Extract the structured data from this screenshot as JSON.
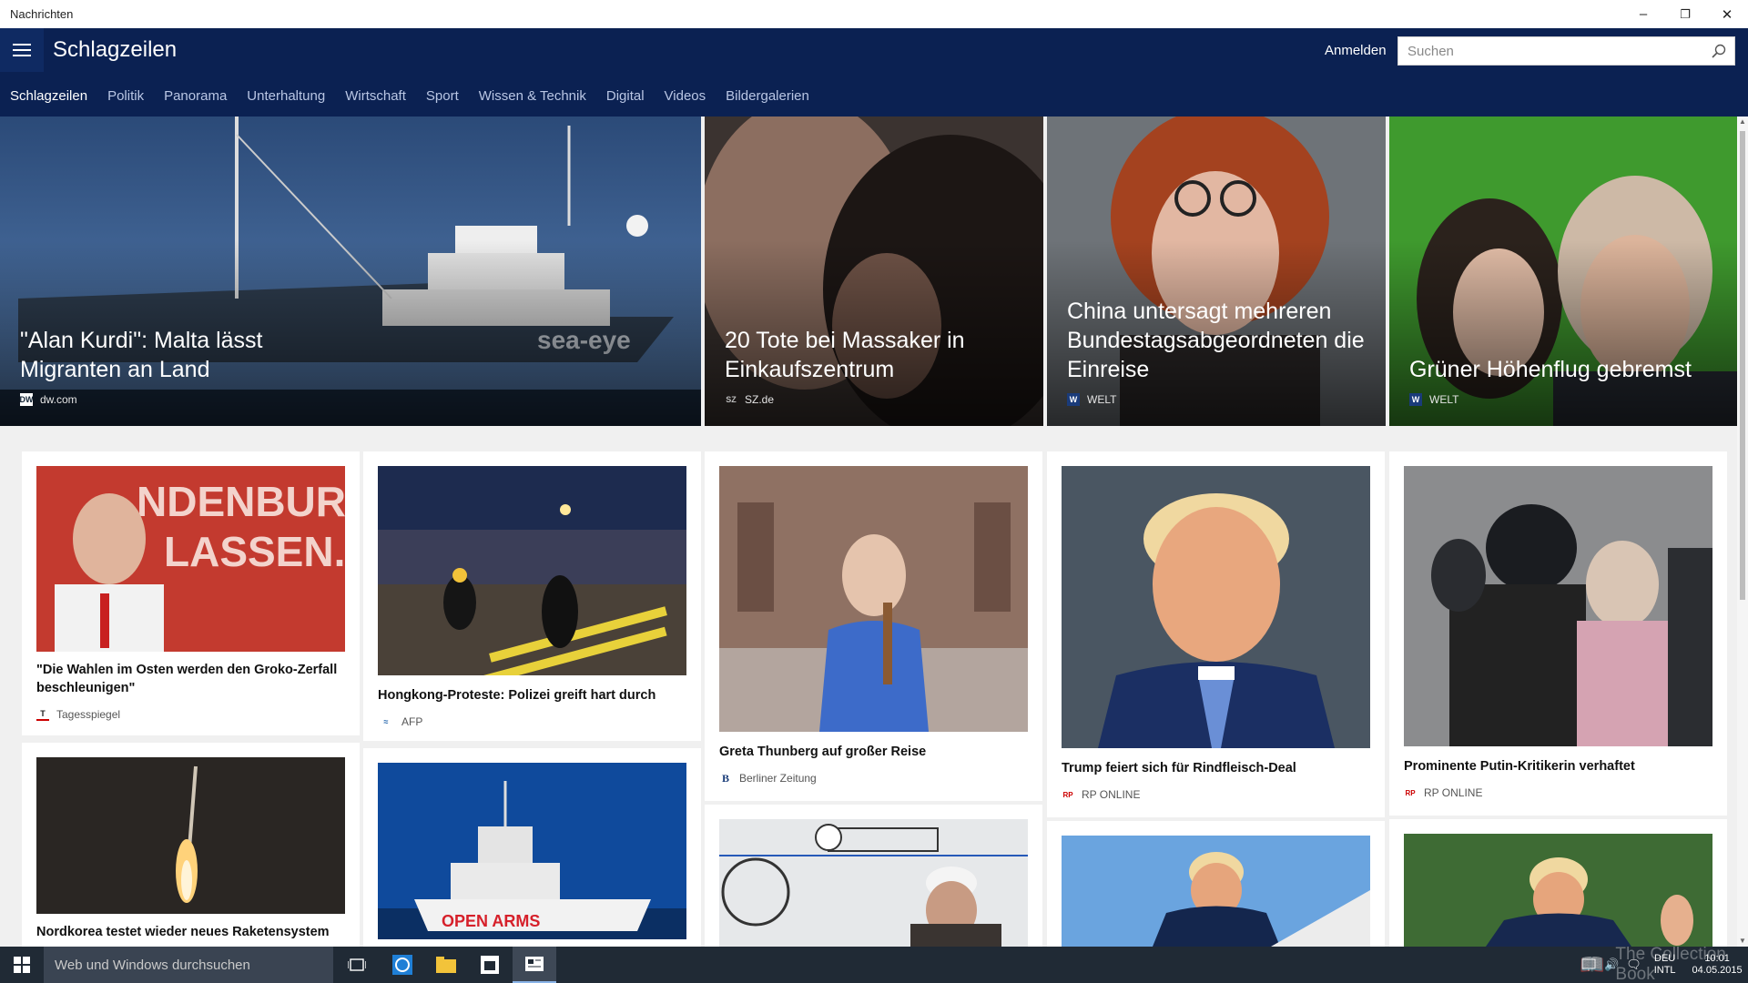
{
  "window": {
    "title": "Nachrichten"
  },
  "header": {
    "page_title": "Schlagzeilen",
    "signin_label": "Anmelden",
    "search_placeholder": "Suchen",
    "bg_color": "#0b2152"
  },
  "nav": {
    "tabs": [
      {
        "label": "Schlagzeilen",
        "active": true
      },
      {
        "label": "Politik"
      },
      {
        "label": "Panorama"
      },
      {
        "label": "Unterhaltung"
      },
      {
        "label": "Wirtschaft"
      },
      {
        "label": "Sport"
      },
      {
        "label": "Wissen & Technik"
      },
      {
        "label": "Digital"
      },
      {
        "label": "Videos"
      },
      {
        "label": "Bildergalerien"
      }
    ]
  },
  "hero": [
    {
      "title": "\"Alan Kurdi\": Malta lässt Migranten an Land",
      "source": "dw.com",
      "logo": "DW"
    },
    {
      "title": "20 Tote bei Massaker in Einkaufszentrum",
      "source": "SZ.de",
      "logo": "SZ"
    },
    {
      "title": "China untersagt mehreren Bundestagsabgeordneten die Einreise",
      "source": "WELT",
      "logo": "W"
    },
    {
      "title": "Grüner Höhenflug gebremst",
      "source": "WELT",
      "logo": "W"
    }
  ],
  "cards": [
    {
      "title": "\"Die Wahlen im Osten werden den Groko-Zerfall beschleunigen\"",
      "source": "Tagesspiegel",
      "logo": "T",
      "image_text": [
        "NDENBURG",
        "LASSEN."
      ]
    },
    {
      "title": "Hongkong-Proteste: Polizei greift hart durch",
      "source": "AFP",
      "logo": "AFP"
    },
    {
      "title": "Greta Thunberg auf großer Reise",
      "source": "Berliner Zeitung",
      "logo": "B"
    },
    {
      "title": "Trump feiert sich für Rindfleisch-Deal",
      "source": "RP ONLINE",
      "logo": "RP"
    },
    {
      "title": "Prominente Putin-Kritikerin verhaftet",
      "source": "RP ONLINE",
      "logo": "RP"
    },
    {
      "title": "Nordkorea testet wieder neues Raketensystem"
    },
    {
      "title": "",
      "image_text": "OPEN ARMS"
    }
  ],
  "taskbar": {
    "search_placeholder": "Web und Windows durchsuchen",
    "lang_top": "DEU",
    "lang_bottom": "INTL",
    "time": "10:01",
    "date": "04.05.2015",
    "watermark": "The Collection Book"
  }
}
